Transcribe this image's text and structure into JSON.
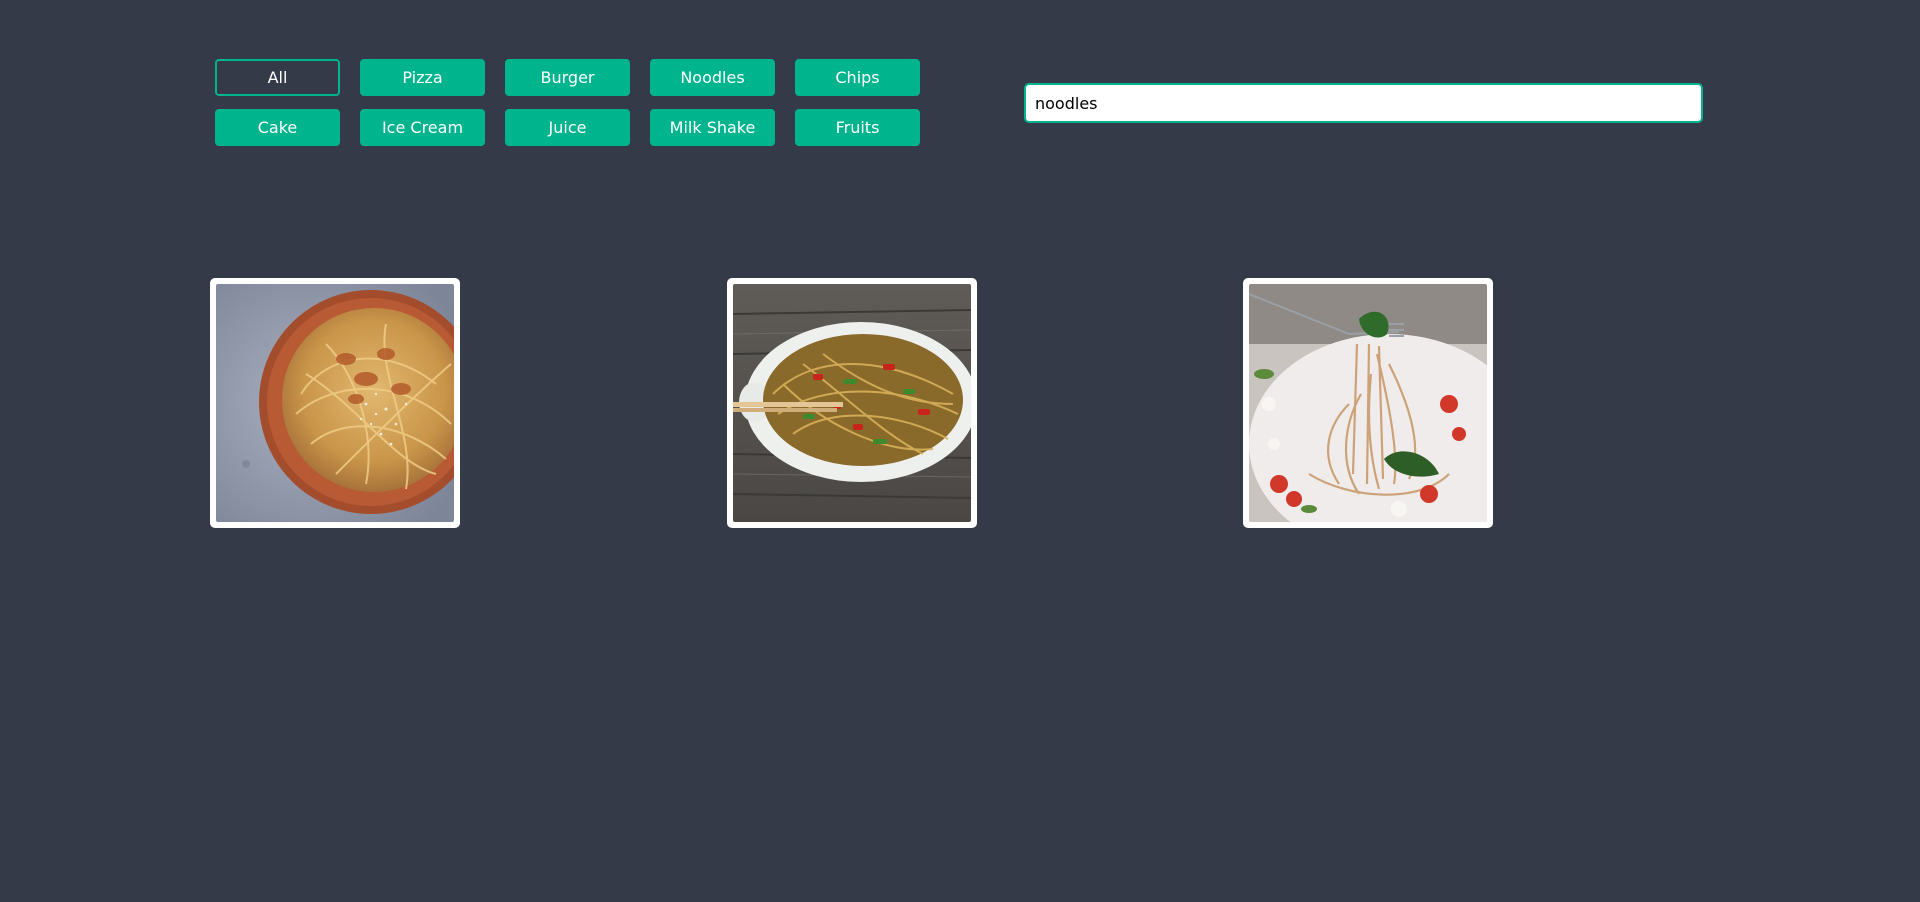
{
  "filters": [
    {
      "label": "All",
      "active": true
    },
    {
      "label": "Pizza",
      "active": false
    },
    {
      "label": "Burger",
      "active": false
    },
    {
      "label": "Noodles",
      "active": false
    },
    {
      "label": "Chips",
      "active": false
    },
    {
      "label": "Cake",
      "active": false
    },
    {
      "label": "Ice Cream",
      "active": false
    },
    {
      "label": "Juice",
      "active": false
    },
    {
      "label": "Milk Shake",
      "active": false
    },
    {
      "label": "Fruits",
      "active": false
    }
  ],
  "search": {
    "value": "noodles",
    "placeholder": ""
  },
  "colors": {
    "background": "#343a48",
    "accent": "#00b48e"
  },
  "gallery": {
    "items": [
      {
        "icon": "spaghetti-bowl-image"
      },
      {
        "icon": "stir-fry-noodles-image"
      },
      {
        "icon": "pasta-on-fork-image"
      }
    ]
  }
}
